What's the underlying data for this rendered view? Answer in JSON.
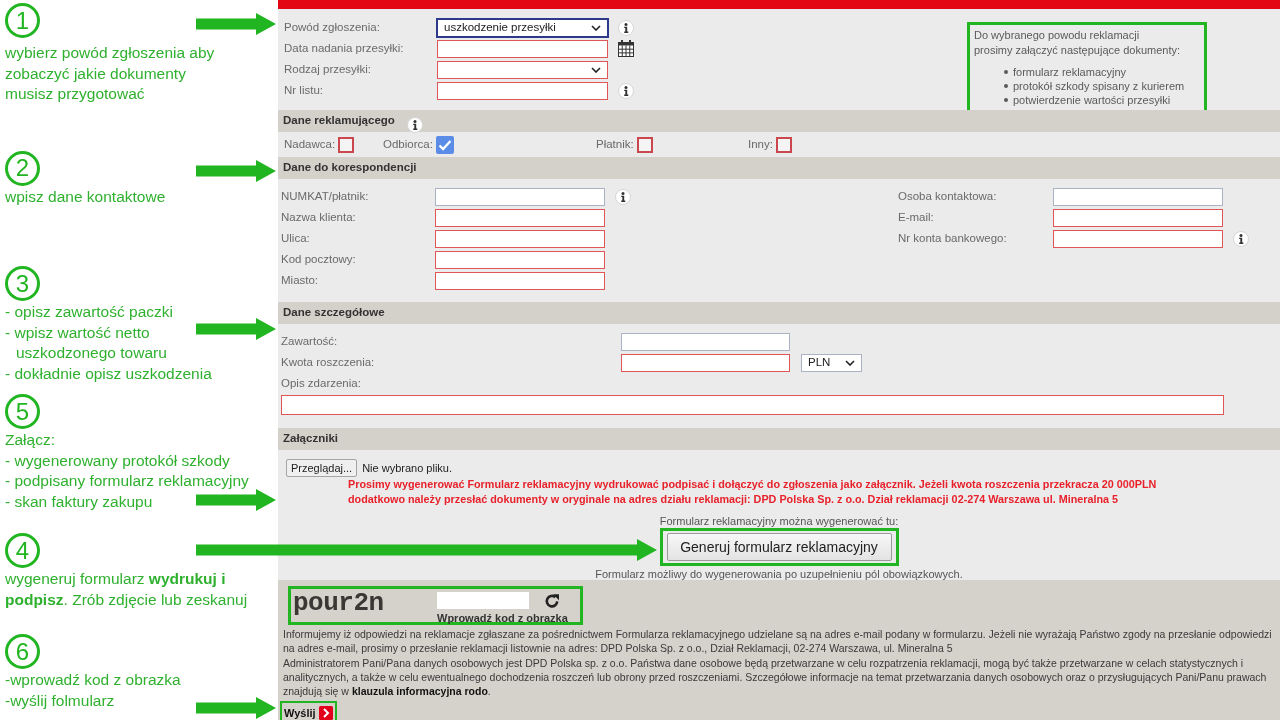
{
  "guide": {
    "steps": [
      {
        "number": "1",
        "lines": [
          "wybierz powód zgłoszenia aby",
          "zobaczyć jakie dokumenty",
          "musisz przygotować"
        ]
      },
      {
        "number": "2",
        "lines": [
          "wpisz dane kontaktowe"
        ]
      },
      {
        "number": "3",
        "items": [
          "- opisz zawartość paczki",
          "- wpisz wartość netto uszkodzonego towaru",
          "- dokładnie opisz uszkodzenia"
        ]
      },
      {
        "number": "5",
        "heading": "Załącz:",
        "items": [
          "- wygenerowany protokół szkody",
          "- podpisany formularz reklamacyjny",
          "- skan faktury zakupu"
        ]
      },
      {
        "number": "4",
        "lines": [
          "wygeneruj formularz **wydrukuj i**",
          "**podpisz**. Zrób zdjęcie lub zeskanuj"
        ]
      },
      {
        "number": "6",
        "lines": [
          "-wprowadź kod z obrazka",
          "-wyślij folmularz"
        ]
      }
    ]
  },
  "claim": {
    "fields": [
      {
        "label": "Powód zgłoszenia:",
        "kind": "select",
        "value": "uszkodzenie przesyłki",
        "focused": true,
        "required": false,
        "help": true,
        "calendar": false
      },
      {
        "label": "Data nadania przesyłki:",
        "kind": "text",
        "focused": false,
        "required": true,
        "help": false,
        "calendar": true
      },
      {
        "label": "Rodzaj przesyłki:",
        "kind": "select",
        "focused": false,
        "required": true,
        "help": false,
        "calendar": false
      },
      {
        "label": "Nr listu:",
        "kind": "text",
        "focused": false,
        "required": true,
        "help": true,
        "calendar": false
      }
    ],
    "documents": {
      "intro_lines": [
        "Do wybranego powodu reklamacji",
        "prosimy załączyć następujące dokumenty:"
      ],
      "items": [
        "formularz reklamacyjny",
        "protokół szkody spisany z kurierem",
        "potwierdzenie wartości przesyłki"
      ]
    }
  },
  "claimant": {
    "title": "Dane reklamującego",
    "parties": [
      {
        "label": "Nadawca:",
        "checked": false
      },
      {
        "label": "Odbiorca:",
        "checked": true
      },
      {
        "label": "Płatnik:",
        "checked": false
      },
      {
        "label": "Inny:",
        "checked": false
      }
    ]
  },
  "correspondence": {
    "title": "Dane do korespondencji",
    "left_fields": [
      {
        "label": "NUMKAT/płatnik:",
        "required": false,
        "help": true
      },
      {
        "label": "Nazwa klienta:",
        "required": true,
        "help": false
      },
      {
        "label": "Ulica:",
        "required": true,
        "help": false
      },
      {
        "label": "Kod pocztowy:",
        "required": true,
        "help": false
      },
      {
        "label": "Miasto:",
        "required": true,
        "help": false
      }
    ],
    "right_fields": [
      {
        "label": "Osoba kontaktowa:",
        "required": false,
        "help": false
      },
      {
        "label": "E-mail:",
        "required": true,
        "help": false
      },
      {
        "label": "Nr konta bankowego:",
        "required": true,
        "help": true
      }
    ]
  },
  "details": {
    "title": "Dane szczegółowe",
    "fields": [
      {
        "label": "Zawartość:",
        "kind": "text",
        "required": false
      },
      {
        "label": "Kwota roszczenia:",
        "kind": "text",
        "required": true,
        "currency": "PLN"
      },
      {
        "label": "Opis zdarzenia:",
        "kind": "textarea",
        "required": true
      }
    ]
  },
  "attachments": {
    "title": "Załączniki",
    "file_button": "Przeglądaj...",
    "file_status": "Nie wybrano pliku.",
    "notice": "Prosimy wygenerować Formularz reklamacyjny wydrukować podpisać i dołączyć do zgłoszenia jako załącznik. Jeżeli kwota roszczenia przekracza 20 000PLN dodatkowo należy przesłać dokumenty w oryginale na adres działu reklamacji: DPD Polska Sp. z o.o. Dział reklamacji 02-274 Warszawa ul. Mineralna 5",
    "generate_hint": "Formularz reklamacyjny można wygenerować tu:",
    "generate_button": "Generuj formularz reklamacyjny",
    "generate_note": "Formularz możliwy do wygenerowania po uzupełnieniu pól obowiązkowych."
  },
  "captcha": {
    "code": "pour2n",
    "caption": "Wprowadź kod z obrazka"
  },
  "privacy": {
    "paragraphs": [
      {
        "text": "Informujemy iż odpowiedzi na reklamacje zgłaszane za pośrednictwem Formularza reklamacyjnego udzielane są na adres e-mail podany w formularzu. Jeżeli nie wyrażają Państwo zgody na przesłanie odpowiedzi na adres e-mail, prosimy o przesłanie reklamacji listownie na adres: DPD Polska Sp. z o.o., Dział Reklamacji, 02-274 Warszawa, ul. Mineralna 5"
      },
      {
        "text": "Administratorem Pani/Pana danych osobowych jest DPD Polska sp. z o.o. Państwa dane osobowe będą przetwarzane w celu rozpatrzenia reklamacji, mogą być także przetwarzane w celach statystycznych i analitycznych, a także w celu ewentualnego dochodzenia roszczeń lub obrony przed roszczeniami. Szczegółowe informacje na temat przetwarzania danych osobowych oraz o przysługujących Pani/Panu prawach znajdują się w",
        "link": "klauzula informacyjna rodo",
        "tail": "."
      }
    ]
  },
  "submit_button": "Wyślij"
}
